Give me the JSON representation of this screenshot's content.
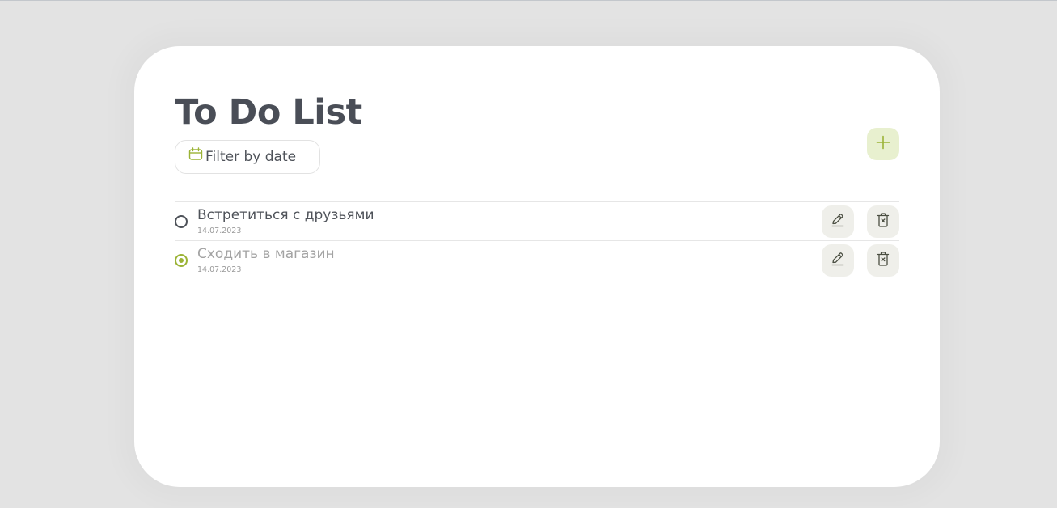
{
  "app": {
    "title": "To Do List"
  },
  "toolbar": {
    "filter_label": "Filter by date",
    "filter_icon": "calendar-icon",
    "add_icon": "plus-icon"
  },
  "colors": {
    "accent": "#9bb336",
    "accent_bg": "#e8f0cf",
    "text": "#4e5259",
    "muted": "#a3a3a3",
    "card": "#ffffff",
    "page_bg": "#e3e3e3"
  },
  "tasks": [
    {
      "title": "Встретиться с друзьями",
      "date": "14.07.2023",
      "completed": false,
      "edit_icon": "pencil-icon",
      "delete_icon": "trash-icon"
    },
    {
      "title": "Сходить в магазин",
      "date": "14.07.2023",
      "completed": true,
      "edit_icon": "pencil-icon",
      "delete_icon": "trash-icon"
    }
  ]
}
